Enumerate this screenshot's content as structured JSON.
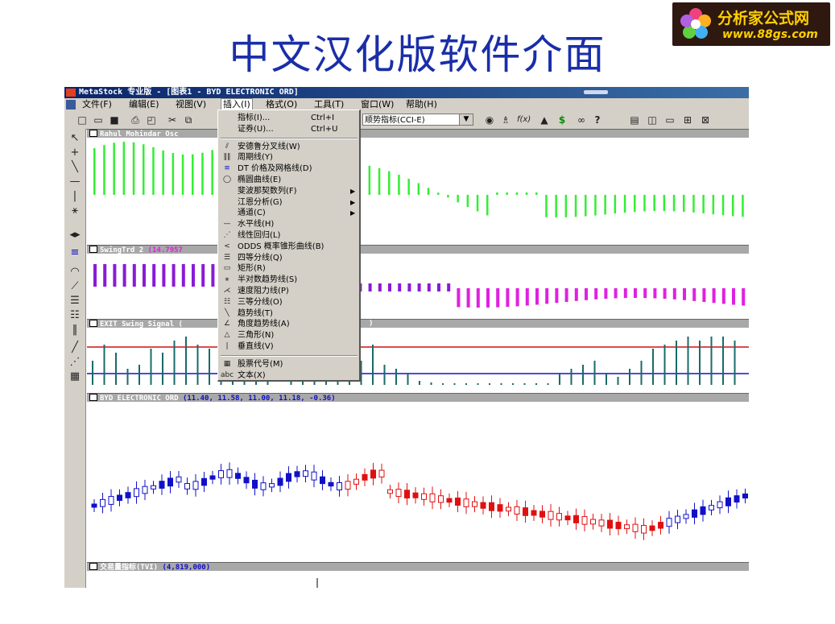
{
  "slide": {
    "title": "中文汉化版软件介面",
    "logo_line1": "分析家公式网",
    "logo_line2": "www.88gs.com"
  },
  "window": {
    "title": "MetaStock 专业版 - [图表1 - BYD ELECTRONIC ORD]"
  },
  "menubar": {
    "items": [
      "文件(F)",
      "编辑(E)",
      "视图(V)",
      "插入(I)",
      "格式(O)",
      "工具(T)",
      "窗口(W)",
      "帮助(H)"
    ]
  },
  "toolbar": {
    "indicator_select": "顺势指标(CCI-E)"
  },
  "insert_menu": {
    "items": [
      {
        "label": "指标(I)...",
        "shortcut": "Ctrl+I",
        "icon": ""
      },
      {
        "label": "证券(U)...",
        "shortcut": "Ctrl+U",
        "icon": ""
      },
      {
        "label": "安德鲁分叉线(W)",
        "icon": "andrews-pitchfork-icon"
      },
      {
        "label": "周期线(Y)",
        "icon": "cycle-lines-icon"
      },
      {
        "label": "DT 价格及网格线(D)",
        "icon": "dt-grid-icon"
      },
      {
        "label": "椭圆曲线(E)",
        "icon": "ellipse-icon"
      },
      {
        "label": "斐波那契数列(F)",
        "icon": "",
        "submenu": true
      },
      {
        "label": "江恩分析(G)",
        "icon": "",
        "submenu": true
      },
      {
        "label": "通道(C)",
        "icon": "",
        "submenu": true
      },
      {
        "label": "水平线(H)",
        "icon": "horizontal-line-icon"
      },
      {
        "label": "线性回归(L)",
        "icon": "linear-regression-icon"
      },
      {
        "label": "ODDS 概率锥形曲线(B)",
        "icon": "odds-cone-icon"
      },
      {
        "label": "四等分线(Q)",
        "icon": "quadrant-lines-icon"
      },
      {
        "label": "矩形(R)",
        "icon": "rectangle-icon"
      },
      {
        "label": "半对数趋势线(S)",
        "icon": "semilog-trendline-icon"
      },
      {
        "label": "速度阻力线(P)",
        "icon": "speed-resistance-icon"
      },
      {
        "label": "三等分线(O)",
        "icon": "tirone-levels-icon"
      },
      {
        "label": "趋势线(T)",
        "icon": "trendline-icon"
      },
      {
        "label": "角度趋势线(A)",
        "icon": "angle-trendline-icon"
      },
      {
        "label": "三角形(N)",
        "icon": "triangle-icon"
      },
      {
        "label": "垂直线(V)",
        "icon": "vertical-line-icon"
      },
      {
        "label": "股票代号(M)",
        "icon": "stock-symbol-icon"
      },
      {
        "label": "文本(X)",
        "icon": "text-icon",
        "icon_text": "abc"
      }
    ]
  },
  "panels": {
    "osc_title": "Rahul Mohindar Osc",
    "swing_title": "SwingTrd 2",
    "swing_value": "(14.7957",
    "exit_title": "EXIT Swing Signal  (",
    "exit_tail": ")",
    "price_title": "BYD ELECTRONIC ORD",
    "price_values": "(11.40, 11.58, 11.00, 11.18, -0.36)",
    "volume_title": "交易量指标(TVI)",
    "volume_value": "(4,819,000)"
  },
  "colors": {
    "osc_bars": "#33ee33",
    "swing_purple": "#8a1ad8",
    "swing_magenta": "#e020e0",
    "exit_bars": "#1a6a6a",
    "exit_upper_line": "#d01010",
    "exit_lower_line": "#1010c8",
    "candle_blue": "#1010c8",
    "candle_red": "#e01010",
    "title_blue": "#1a2ea8"
  }
}
